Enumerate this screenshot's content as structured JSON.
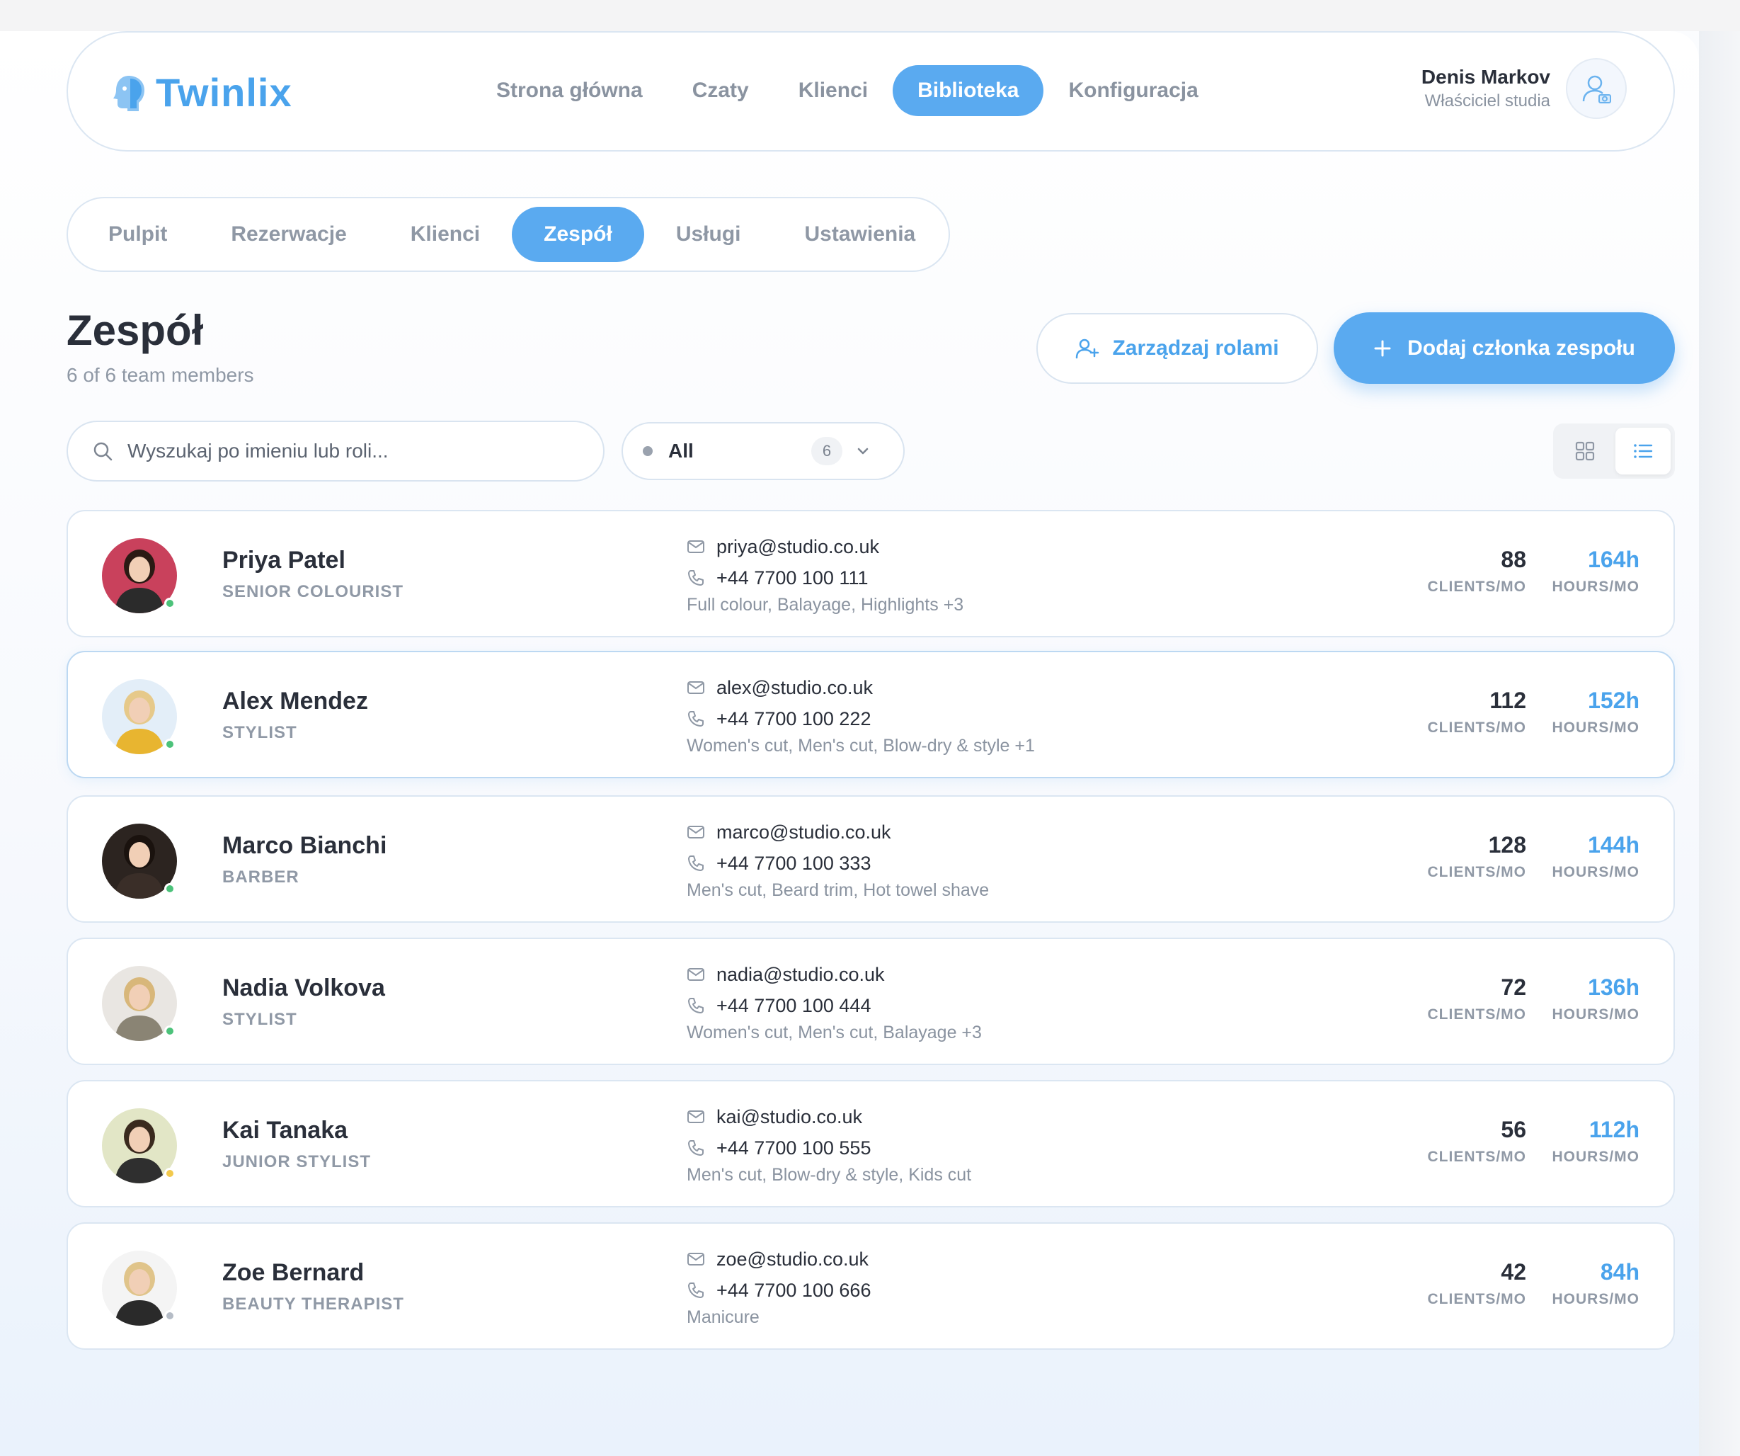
{
  "app": {
    "logo_text": "Twinlix",
    "accent": "#5aaaf0",
    "nav": [
      {
        "label": "Strona główna",
        "active": false
      },
      {
        "label": "Czaty",
        "active": false
      },
      {
        "label": "Klienci",
        "active": false
      },
      {
        "label": "Biblioteka",
        "active": true
      },
      {
        "label": "Konfiguracja",
        "active": false
      }
    ],
    "user": {
      "name": "Denis Markov",
      "role": "Właściciel studia"
    }
  },
  "subnav": [
    {
      "label": "Pulpit",
      "active": false
    },
    {
      "label": "Rezerwacje",
      "active": false
    },
    {
      "label": "Klienci",
      "active": false
    },
    {
      "label": "Zespół",
      "active": true
    },
    {
      "label": "Usługi",
      "active": false
    },
    {
      "label": "Ustawienia",
      "active": false
    }
  ],
  "page": {
    "title": "Zespół",
    "subtitle": "6 of 6 team members",
    "manage_roles_label": "Zarządzaj rolami",
    "add_member_label": "Dodaj członka zespołu"
  },
  "filters": {
    "search_placeholder": "Wyszukaj po imieniu lub roli...",
    "status_label": "All",
    "status_count": "6",
    "view_mode": "list"
  },
  "stat_labels": {
    "clients": "CLIENTS/MO",
    "hours": "HOURS/MO"
  },
  "members": [
    {
      "name": "Priya Patel",
      "role": "SENIOR COLOURIST",
      "email": "priya@studio.co.uk",
      "phone": "+44 7700 100 111",
      "services": "Full colour, Balayage, Highlights +3",
      "clients": "88",
      "hours": "164h",
      "status": "#4cc27a",
      "avatar_bg": "#c9415c",
      "shirt": "#2b2b2b",
      "hair": "#2a1a14"
    },
    {
      "name": "Alex Mendez",
      "role": "STYLIST",
      "email": "alex@studio.co.uk",
      "phone": "+44 7700 100 222",
      "services": "Women's cut, Men's cut, Blow-dry & style +1",
      "clients": "112",
      "hours": "152h",
      "status": "#4cc27a",
      "avatar_bg": "#e3eef8",
      "shirt": "#e8b530",
      "hair": "#e6c98a"
    },
    {
      "name": "Marco Bianchi",
      "role": "BARBER",
      "email": "marco@studio.co.uk",
      "phone": "+44 7700 100 333",
      "services": "Men's cut, Beard trim, Hot towel shave",
      "clients": "128",
      "hours": "144h",
      "status": "#4cc27a",
      "avatar_bg": "#2c2420",
      "shirt": "#3a2e28",
      "hair": "#1a120e"
    },
    {
      "name": "Nadia Volkova",
      "role": "STYLIST",
      "email": "nadia@studio.co.uk",
      "phone": "+44 7700 100 444",
      "services": "Women's cut, Men's cut, Balayage +3",
      "clients": "72",
      "hours": "136h",
      "status": "#4cc27a",
      "avatar_bg": "#e9e6e2",
      "shirt": "#8a8474",
      "hair": "#d8b77a"
    },
    {
      "name": "Kai Tanaka",
      "role": "JUNIOR STYLIST",
      "email": "kai@studio.co.uk",
      "phone": "+44 7700 100 555",
      "services": "Men's cut, Blow-dry & style, Kids cut",
      "clients": "56",
      "hours": "112h",
      "status": "#f2c94c",
      "avatar_bg": "#e2e6c6",
      "shirt": "#2f2f2f",
      "hair": "#3a2a1e"
    },
    {
      "name": "Zoe Bernard",
      "role": "BEAUTY THERAPIST",
      "email": "zoe@studio.co.uk",
      "phone": "+44 7700 100 666",
      "services": "Manicure",
      "clients": "42",
      "hours": "84h",
      "status": "#b5bcc6",
      "avatar_bg": "#f4f4f4",
      "shirt": "#2a2a2a",
      "hair": "#e0c48a"
    }
  ]
}
